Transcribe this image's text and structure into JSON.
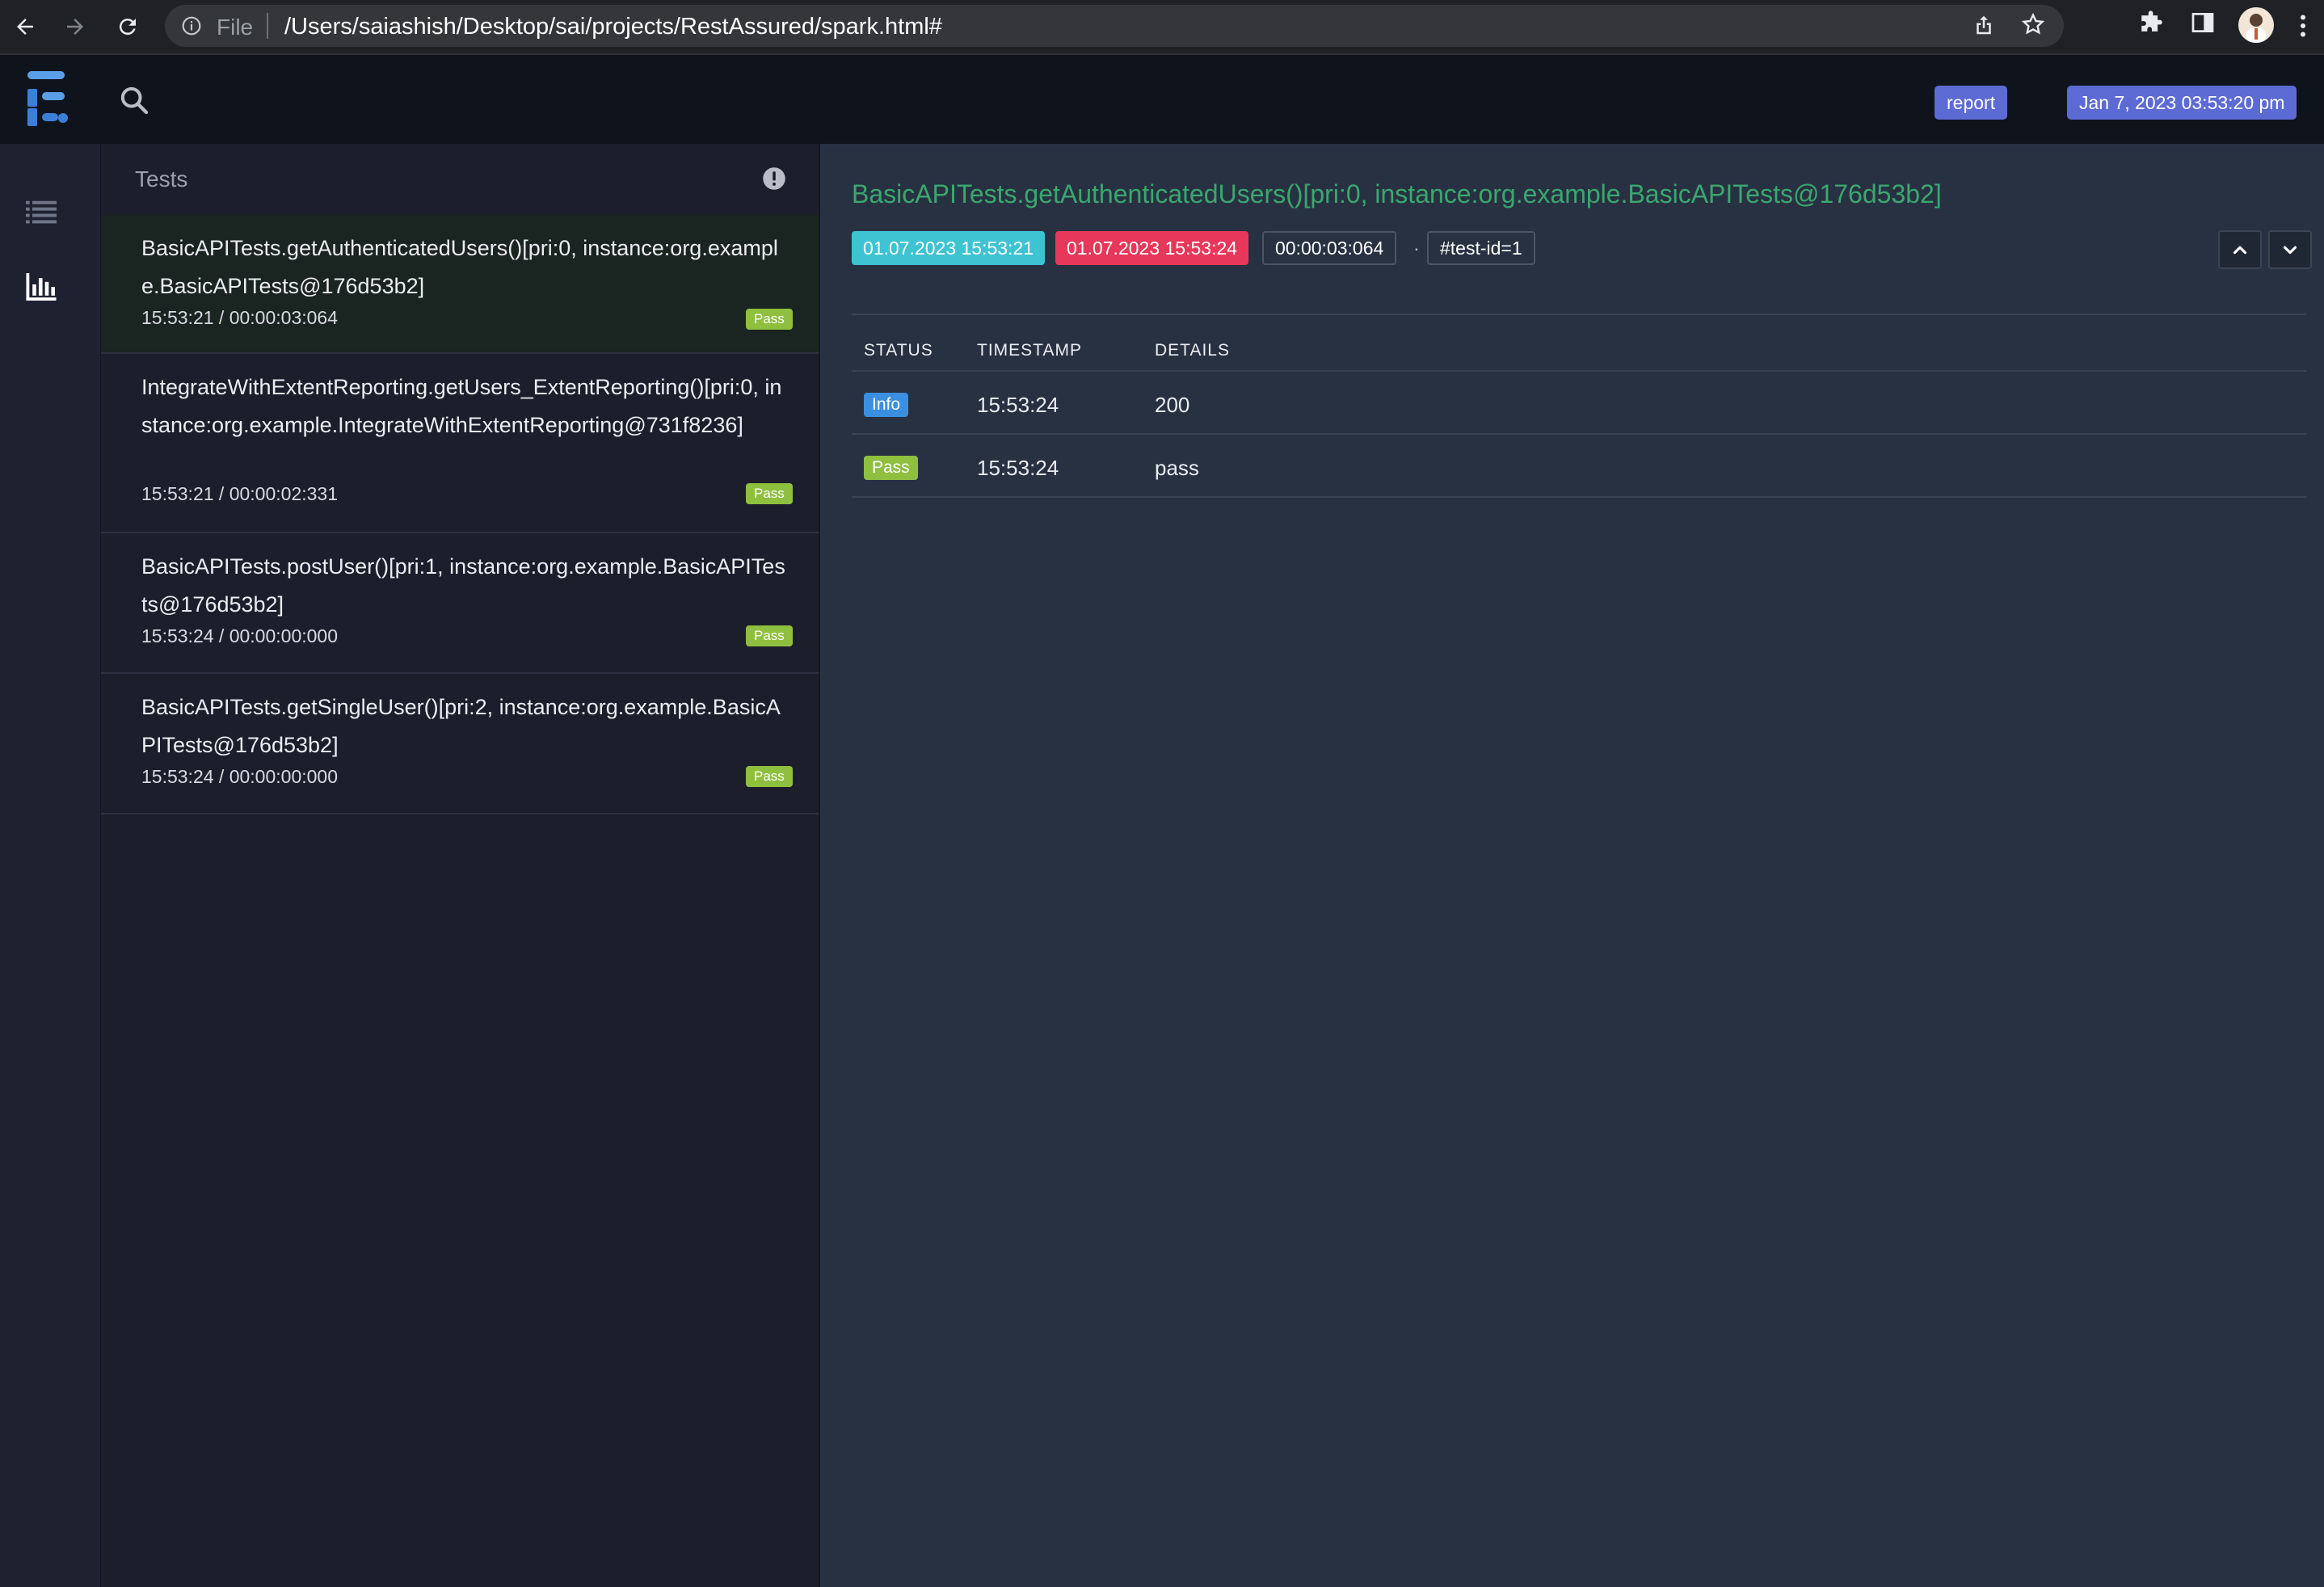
{
  "browser": {
    "file_label": "File",
    "url": "/Users/saiashish/Desktop/sai/projects/RestAssured/spark.html#"
  },
  "header": {
    "report_label": "report",
    "date_label": "Jan 7, 2023 03:53:20 pm",
    "accent_color": "#5c6bd4"
  },
  "tests_panel": {
    "title": "Tests",
    "items": [
      {
        "name": "BasicAPITests.getAuthenticatedUsers()[pri:0, instance:org.example.BasicAPITests@176d53b2]",
        "time": "15:53:21 / 00:00:03:064",
        "status": "Pass"
      },
      {
        "name": "IntegrateWithExtentReporting.getUsers_ExtentReporting()[pri:0, instance:org.example.IntegrateWithExtentReporting@731f8236]",
        "time": "15:53:21 / 00:00:02:331",
        "status": "Pass"
      },
      {
        "name": "BasicAPITests.postUser()[pri:1, instance:org.example.BasicAPITests@176d53b2]",
        "time": "15:53:24 / 00:00:00:000",
        "status": "Pass"
      },
      {
        "name": "BasicAPITests.getSingleUser()[pri:2, instance:org.example.BasicAPITests@176d53b2]",
        "time": "15:53:24 / 00:00:00:000",
        "status": "Pass"
      }
    ]
  },
  "detail": {
    "title": "BasicAPITests.getAuthenticatedUsers()[pri:0, instance:org.example.BasicAPITests@176d53b2]",
    "start": "01.07.2023 15:53:21",
    "end": "01.07.2023 15:53:24",
    "duration": "00:00:03:064",
    "separator": "·",
    "test_id": "#test-id=1",
    "columns": [
      "STATUS",
      "TIMESTAMP",
      "DETAILS"
    ],
    "rows": [
      {
        "status": "Info",
        "timestamp": "15:53:24",
        "details": "200",
        "color": "#3b8fe0"
      },
      {
        "status": "Pass",
        "timestamp": "15:53:24",
        "details": "pass",
        "color": "#8fbf3e"
      }
    ],
    "title_color": "#39a86e"
  },
  "icons": {
    "back": "arrow-left-icon",
    "forward": "arrow-right-icon",
    "reload": "reload-icon",
    "info": "info-icon",
    "share": "share-icon",
    "bookmark": "star-icon",
    "extensions": "puzzle-icon",
    "sidepanel": "side-panel-icon",
    "menu": "kebab-menu-icon",
    "logo": "extent-logo-icon",
    "search": "search-icon",
    "tests_nav": "list-icon",
    "dashboard_nav": "bar-chart-icon",
    "alert": "alert-icon",
    "up": "chevron-up-icon",
    "down": "chevron-down-icon"
  }
}
